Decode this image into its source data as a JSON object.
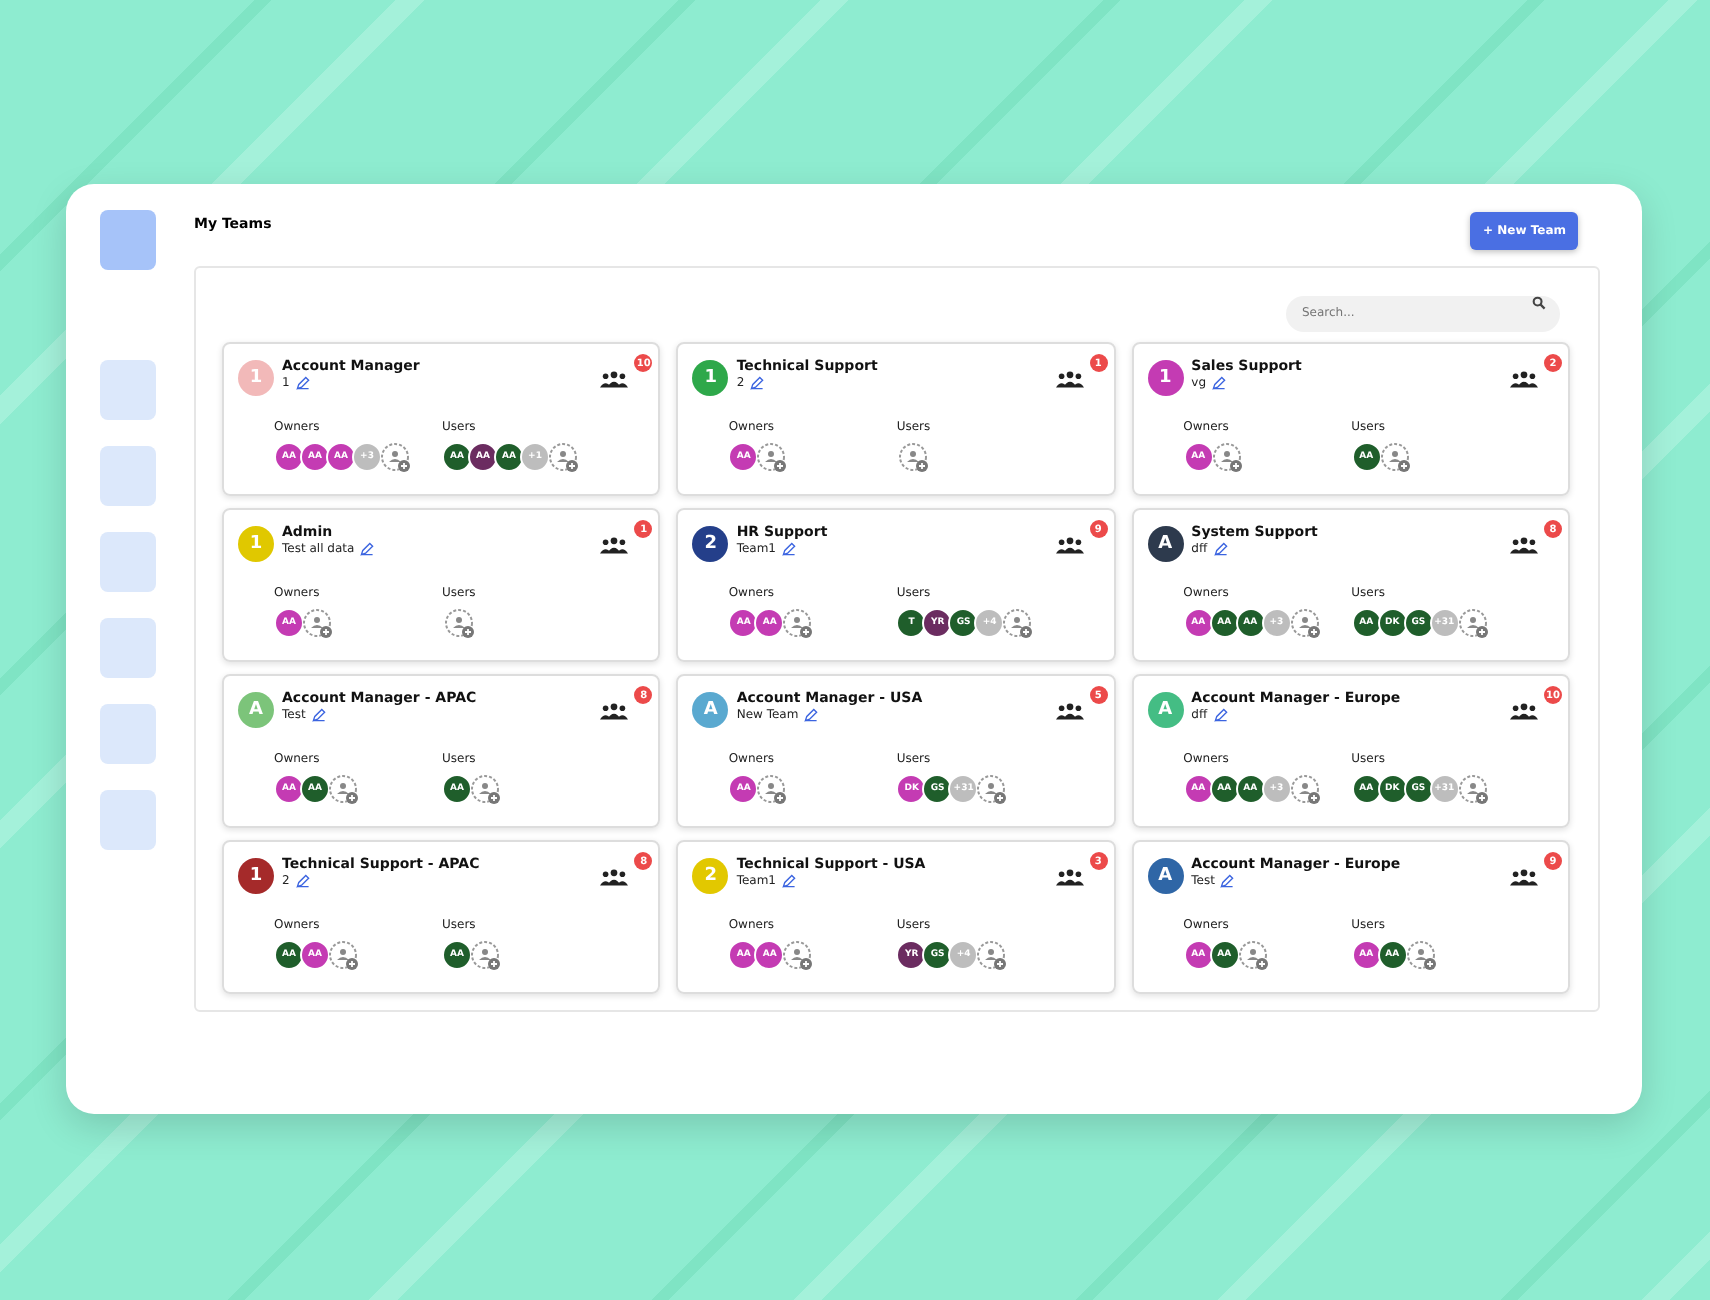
{
  "page": {
    "title": "My Teams",
    "new_button": "+ New Team",
    "search": {
      "placeholder": "Search..."
    },
    "sidebar": {
      "items": [
        {
          "selected": true
        },
        {
          "selected": false
        },
        {
          "selected": false
        },
        {
          "selected": false
        },
        {
          "selected": false
        },
        {
          "selected": false
        },
        {
          "selected": false
        }
      ]
    }
  },
  "teams": [
    {
      "letter": "1",
      "color": "#f2b9b9",
      "name": "Account Manager",
      "subtitle": "1",
      "count": "10",
      "owners_label": "Owners",
      "users_label": "Users",
      "owners": [
        {
          "text": "AA",
          "color": "#c43bb3"
        },
        {
          "text": "AA",
          "color": "#c43bb3"
        },
        {
          "text": "AA",
          "color": "#c43bb3"
        },
        {
          "text": "+3",
          "color": "#bdbdbd"
        }
      ],
      "users": [
        {
          "text": "AA",
          "color": "#1f5e2b"
        },
        {
          "text": "AA",
          "color": "#6b2c60"
        },
        {
          "text": "AA",
          "color": "#1f5e2b"
        },
        {
          "text": "+1",
          "color": "#bdbdbd"
        }
      ]
    },
    {
      "letter": "1",
      "color": "#2ea84a",
      "name": "Technical Support",
      "subtitle": "2",
      "count": "1",
      "owners_label": "Owners",
      "users_label": "Users",
      "owners": [
        {
          "text": "AA",
          "color": "#c43bb3"
        }
      ]
    },
    {
      "letter": "1",
      "color": "#c43bb3",
      "name": "Sales Support",
      "subtitle": "vg",
      "count": "2",
      "owners_label": "Owners",
      "users_label": "Users",
      "owners": [
        {
          "text": "AA",
          "color": "#c43bb3"
        }
      ],
      "users": [
        {
          "text": "AA",
          "color": "#1f5e2b"
        }
      ]
    },
    {
      "letter": "1",
      "color": "#e0c800",
      "name": "Admin",
      "subtitle": "Test all data",
      "count": "1",
      "owners_label": "Owners",
      "users_label": "Users",
      "owners": [
        {
          "text": "AA",
          "color": "#c43bb3"
        }
      ]
    },
    {
      "letter": "2",
      "color": "#243f8a",
      "name": "HR Support",
      "subtitle": "Team1",
      "count": "9",
      "owners_label": "Owners",
      "users_label": "Users",
      "owners": [
        {
          "text": "AA",
          "color": "#c43bb3"
        },
        {
          "text": "AA",
          "color": "#c43bb3"
        }
      ],
      "users": [
        {
          "text": "T",
          "color": "#1f5e2b"
        },
        {
          "text": "YR",
          "color": "#6b2c60"
        },
        {
          "text": "GS",
          "color": "#1f5e2b"
        },
        {
          "text": "+4",
          "color": "#bdbdbd"
        }
      ]
    },
    {
      "letter": "A",
      "color": "#2d3a4d",
      "name": "System Support",
      "subtitle": "dff",
      "count": "8",
      "owners_label": "Owners",
      "users_label": "Users",
      "owners": [
        {
          "text": "AA",
          "color": "#c43bb3"
        },
        {
          "text": "AA",
          "color": "#1f5e2b"
        },
        {
          "text": "AA",
          "color": "#1f5e2b"
        },
        {
          "text": "+3",
          "color": "#bdbdbd"
        }
      ],
      "users": [
        {
          "text": "AA",
          "color": "#1f5e2b"
        },
        {
          "text": "DK",
          "color": "#1f5e2b"
        },
        {
          "text": "GS",
          "color": "#1f5e2b"
        },
        {
          "text": "+31",
          "color": "#bdbdbd"
        }
      ]
    },
    {
      "letter": "A",
      "color": "#7cc47a",
      "name": "Account Manager - APAC",
      "subtitle": "Test",
      "count": "8",
      "owners_label": "Owners",
      "users_label": "Users",
      "owners": [
        {
          "text": "AA",
          "color": "#c43bb3"
        },
        {
          "text": "AA",
          "color": "#1f5e2b"
        }
      ],
      "users": [
        {
          "text": "AA",
          "color": "#1f5e2b"
        }
      ]
    },
    {
      "letter": "A",
      "color": "#5aa9d0",
      "name": "Account Manager - USA",
      "subtitle": "New Team",
      "count": "5",
      "owners_label": "Owners",
      "users_label": "Users",
      "owners": [
        {
          "text": "AA",
          "color": "#c43bb3"
        }
      ],
      "users": [
        {
          "text": "DK",
          "color": "#c43bb3"
        },
        {
          "text": "GS",
          "color": "#1f5e2b"
        },
        {
          "text": "+31",
          "color": "#bdbdbd"
        }
      ]
    },
    {
      "letter": "A",
      "color": "#44bd84",
      "name": "Account Manager - Europe",
      "subtitle": "dff",
      "count": "10",
      "owners_label": "Owners",
      "users_label": "Users",
      "owners": [
        {
          "text": "AA",
          "color": "#c43bb3"
        },
        {
          "text": "AA",
          "color": "#1f5e2b"
        },
        {
          "text": "AA",
          "color": "#1f5e2b"
        },
        {
          "text": "+3",
          "color": "#bdbdbd"
        }
      ],
      "users": [
        {
          "text": "AA",
          "color": "#1f5e2b"
        },
        {
          "text": "DK",
          "color": "#1f5e2b"
        },
        {
          "text": "GS",
          "color": "#1f5e2b"
        },
        {
          "text": "+31",
          "color": "#bdbdbd"
        }
      ]
    },
    {
      "letter": "1",
      "color": "#a52a2a",
      "name": "Technical Support - APAC",
      "subtitle": "2",
      "count": "8",
      "owners_label": "Owners",
      "users_label": "Users",
      "owners": [
        {
          "text": "AA",
          "color": "#1f5e2b"
        },
        {
          "text": "AA",
          "color": "#c43bb3"
        }
      ],
      "users": [
        {
          "text": "AA",
          "color": "#1f5e2b"
        }
      ]
    },
    {
      "letter": "2",
      "color": "#e2c800",
      "name": "Technical Support - USA",
      "subtitle": "Team1",
      "count": "3",
      "owners_label": "Owners",
      "users_label": "Users",
      "owners": [
        {
          "text": "AA",
          "color": "#c43bb3"
        },
        {
          "text": "AA",
          "color": "#c43bb3"
        }
      ],
      "users": [
        {
          "text": "YR",
          "color": "#6b2c60"
        },
        {
          "text": "GS",
          "color": "#1f5e2b"
        },
        {
          "text": "+4",
          "color": "#bdbdbd"
        }
      ]
    },
    {
      "letter": "A",
      "color": "#2f66a6",
      "name": "Account Manager - Europe",
      "subtitle": "Test",
      "count": "9",
      "owners_label": "Owners",
      "users_label": "Users",
      "owners": [
        {
          "text": "AA",
          "color": "#c43bb3"
        },
        {
          "text": "AA",
          "color": "#1f5e2b"
        }
      ],
      "users": [
        {
          "text": "AA",
          "color": "#c43bb3"
        },
        {
          "text": "AA",
          "color": "#1f5e2b"
        }
      ]
    }
  ]
}
